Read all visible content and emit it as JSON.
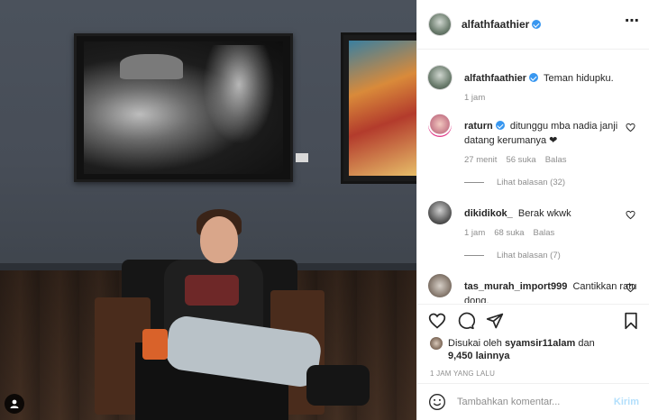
{
  "post": {
    "username": "alfathfaathier",
    "more_icon": "⋯"
  },
  "caption": {
    "username": "alfathfaathier",
    "text": "Teman hidupku.",
    "time": "1 jam"
  },
  "comments": [
    {
      "username": "raturn",
      "text": "ditunggu mba nadia janji datang kerumanya ❤",
      "time": "27 menit",
      "likes": "56 suka",
      "reply": "Balas",
      "view_replies": "Lihat balasan (32)"
    },
    {
      "username": "dikidikok_",
      "text": "Berak wkwk",
      "time": "1 jam",
      "likes": "68 suka",
      "reply": "Balas",
      "view_replies": "Lihat balasan (7)"
    },
    {
      "username": "tas_murah_import999",
      "text": "Cantikkan ratu dong."
    }
  ],
  "likes": {
    "prefix": "Disukai oleh",
    "user": "syamsir11alam",
    "connector": "dan",
    "count": "9,450 lainnya"
  },
  "posted_ago": "1 JAM YANG LALU",
  "add_comment": {
    "placeholder": "Tambahkan komentar...",
    "post_label": "Kirim"
  },
  "icons": [
    "user-tag-icon",
    "heart-icon",
    "comment-icon",
    "share-icon",
    "bookmark-icon",
    "emoji-icon",
    "verified-icon",
    "more-icon"
  ],
  "colors": {
    "link_blue": "#3897f0",
    "post_button_disabled": "#b2dffc",
    "muted": "#8e8e8e"
  }
}
